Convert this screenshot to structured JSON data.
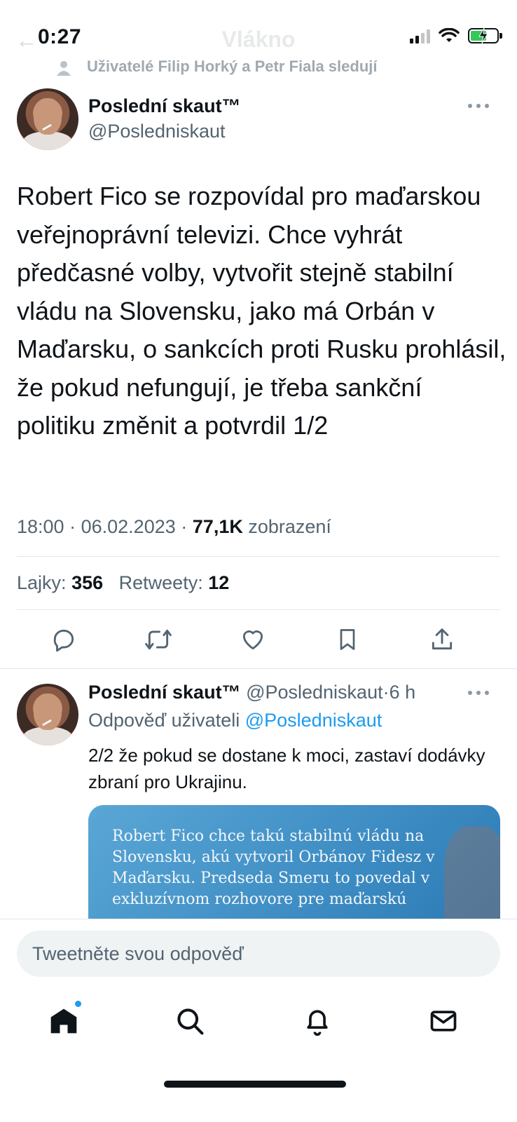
{
  "status_bar": {
    "time": "0:27",
    "battery_charging": true,
    "battery_color": "#34c759"
  },
  "header": {
    "title": "Vlákno"
  },
  "social_context": "Uživatelé Filip Horký a Petr Fiala sledují",
  "main_tweet": {
    "author_name": "Poslední skaut™",
    "author_handle": "@Posledniskaut",
    "text": "Robert Fico se rozpovídal pro maďarskou veřejnoprávní televizi. Chce vyhrát předčasné volby, vytvořit stejně stabilní vládu na Slovensku, jako má Orbán v Maďarsku, o sankcích proti Rusku prohlásil, že pokud nefungují, je třeba sankční politiku změnit a potvrdil 1/2",
    "time": "18:00",
    "separator": "·",
    "date": "06.02.2023",
    "views_count": "77,1K",
    "views_label": "zobrazení",
    "likes_label": "Lajky:",
    "likes_count": "356",
    "retweets_label": "Retweety:",
    "retweets_count": "12",
    "actions": [
      "reply-icon",
      "retweet-icon",
      "like-icon",
      "bookmark-icon",
      "share-icon"
    ]
  },
  "reply_tweet": {
    "author_name": "Poslední skaut™",
    "author_handle": "@Posledniskaut",
    "separator": "·",
    "age": "6 h",
    "reply_to_label": "Odpověď uživateli",
    "reply_to_handle": "@Posledniskaut",
    "text": "2/2 že pokud se dostane k moci, zastaví dodávky zbraní pro Ukrajinu.",
    "card_text": "Robert Fico chce takú stabilnú vládu na Slovensku, akú vytvoril Orbánov Fidesz v Maďarsku. Predseda Smeru to povedal v exkluzívnom rozhovore pre maďarskú"
  },
  "composer": {
    "placeholder": "Tweetněte svou odpověď"
  },
  "tabbar": {
    "items": [
      "home-icon",
      "search-icon",
      "notifications-icon",
      "messages-icon"
    ],
    "accent": "#1d9bf0"
  }
}
